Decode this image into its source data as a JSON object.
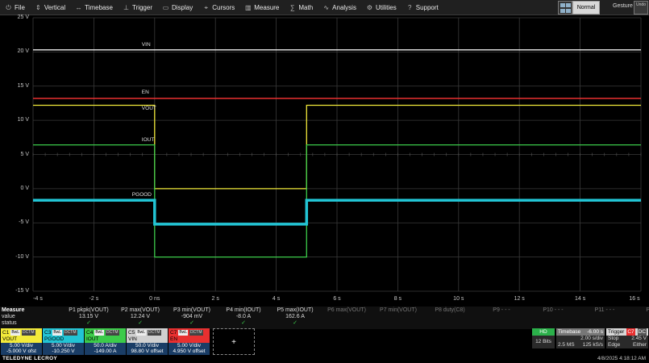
{
  "menu": [
    {
      "label": "File",
      "icon": "power-icon"
    },
    {
      "label": "Vertical",
      "icon": "vertical-icon"
    },
    {
      "label": "Timebase",
      "icon": "timebase-icon"
    },
    {
      "label": "Trigger",
      "icon": "trigger-icon"
    },
    {
      "label": "Display",
      "icon": "display-icon"
    },
    {
      "label": "Cursors",
      "icon": "cursors-icon"
    },
    {
      "label": "Measure",
      "icon": "measure-icon"
    },
    {
      "label": "Math",
      "icon": "math-icon"
    },
    {
      "label": "Analysis",
      "icon": "analysis-icon"
    },
    {
      "label": "Utilities",
      "icon": "utilities-icon"
    },
    {
      "label": "Support",
      "icon": "support-icon"
    }
  ],
  "toolbar": {
    "trigger_mode": "Normal",
    "gesture": "Gesture",
    "undo": "Undo"
  },
  "colors": {
    "vin": "#f0f0f0",
    "en": "#e83030",
    "vout": "#f2ea3a",
    "iout": "#3ccb4a",
    "pgood": "#22c4d4",
    "grid": "#3a3a3a"
  },
  "chart_data": {
    "type": "line",
    "y_ticks": [
      "25 V",
      "20 V",
      "15 V",
      "10 V",
      "5 V",
      "0 V",
      "-5 V",
      "-10 V",
      "-15 V"
    ],
    "x_ticks": [
      "-4 s",
      "-2 s",
      "0 ns",
      "2 s",
      "4 s",
      "6 s",
      "8 s",
      "10 s",
      "12 s",
      "14 s",
      "16 s"
    ],
    "xlim": [
      -4,
      16
    ],
    "ylim": [
      -15,
      25
    ],
    "series": [
      {
        "name": "VIN",
        "color": "#f0f0f0",
        "points": [
          [
            -4,
            20.3
          ],
          [
            16,
            20.3
          ]
        ]
      },
      {
        "name": "EN",
        "color": "#e83030",
        "points": [
          [
            -4,
            13.2
          ],
          [
            16,
            13.2
          ]
        ]
      },
      {
        "name": "VOUT",
        "color": "#f2ea3a",
        "points": [
          [
            -4,
            12.2
          ],
          [
            0,
            12.2
          ],
          [
            0,
            0
          ],
          [
            5,
            0
          ],
          [
            5,
            12.2
          ],
          [
            16,
            12.2
          ]
        ]
      },
      {
        "name": "IOUT",
        "color": "#3ccb4a",
        "points": [
          [
            -4,
            6.4
          ],
          [
            0,
            6.4
          ],
          [
            0,
            -10
          ],
          [
            5,
            -10
          ],
          [
            5,
            6.4
          ],
          [
            16,
            6.4
          ]
        ]
      },
      {
        "name": "PGOOD",
        "color": "#22c4d4",
        "points": [
          [
            -4,
            -1.7
          ],
          [
            0,
            -1.7
          ],
          [
            0,
            -5.2
          ],
          [
            5,
            -5.2
          ],
          [
            5,
            -1.7
          ],
          [
            16,
            -1.7
          ]
        ]
      }
    ],
    "trace_labels": [
      "VIN",
      "EN",
      "VOUT",
      "IOUT",
      "PGOOD"
    ]
  },
  "measure": {
    "title": "Measure",
    "row_labels": [
      "value",
      "status"
    ],
    "params": [
      {
        "name": "P1 pkpk(VOUT)",
        "value": "13.15 V",
        "active": true
      },
      {
        "name": "P2 max(VOUT)",
        "value": "12.24 V",
        "active": true
      },
      {
        "name": "P3 min(VOUT)",
        "value": "-904 mV",
        "active": true
      },
      {
        "name": "P4 min(IOUT)",
        "value": "-8.0 A",
        "active": true
      },
      {
        "name": "P5 max(IOUT)",
        "value": "162.6 A",
        "active": true
      },
      {
        "name": "P6 max(VOUT)",
        "value": "",
        "active": false
      },
      {
        "name": "P7 min(VOUT)",
        "value": "",
        "active": false
      },
      {
        "name": "P8 duty(C8)",
        "value": "",
        "active": false
      },
      {
        "name": "P9 - - -",
        "value": "",
        "active": false
      },
      {
        "name": "P10 - - -",
        "value": "",
        "active": false
      },
      {
        "name": "P11 - - -",
        "value": "",
        "active": false
      },
      {
        "name": "P12 - - -",
        "value": "",
        "active": false
      }
    ]
  },
  "channels": [
    {
      "id": "C1",
      "name": "VOUT",
      "color": "#f2ea3a",
      "div": "5.00 V/div",
      "offset": "-5.000 V ofst"
    },
    {
      "id": "C3",
      "name": "PGOOD",
      "color": "#22c4d4",
      "div": "5.00 V/div",
      "offset": "-10.250 V"
    },
    {
      "id": "C4",
      "name": "IOUT",
      "color": "#3ccb4a",
      "div": "50.0 A/div",
      "offset": "-149.00 A"
    },
    {
      "id": "C5",
      "name": "VIN",
      "color": "#d0d0d0",
      "div": "50.0 V/div",
      "offset": "98.80 V offset"
    },
    {
      "id": "C7",
      "name": "EN",
      "color": "#e83030",
      "div": "5.00 V/div",
      "offset": "4.950 V offset"
    }
  ],
  "channel_tags": [
    "BwL",
    "DCTM"
  ],
  "add_channel": "+",
  "acq": {
    "hd": "HD",
    "bits": "12 Bits"
  },
  "timebase": {
    "label": "Timebase",
    "delay": "-6.00 s",
    "rate": "2.00 s/div",
    "samples": "2.5 MS",
    "srate": "125 kS/s"
  },
  "trigger": {
    "label": "Trigger",
    "coupling": "DC",
    "mode": "Stop",
    "level": "2.45 V",
    "type": "Edge",
    "slope": "Either",
    "source": "C7"
  },
  "footer": {
    "brand": "TELEDYNE LECROY",
    "timestamp": "4/8/2025 4:18:12 AM"
  }
}
